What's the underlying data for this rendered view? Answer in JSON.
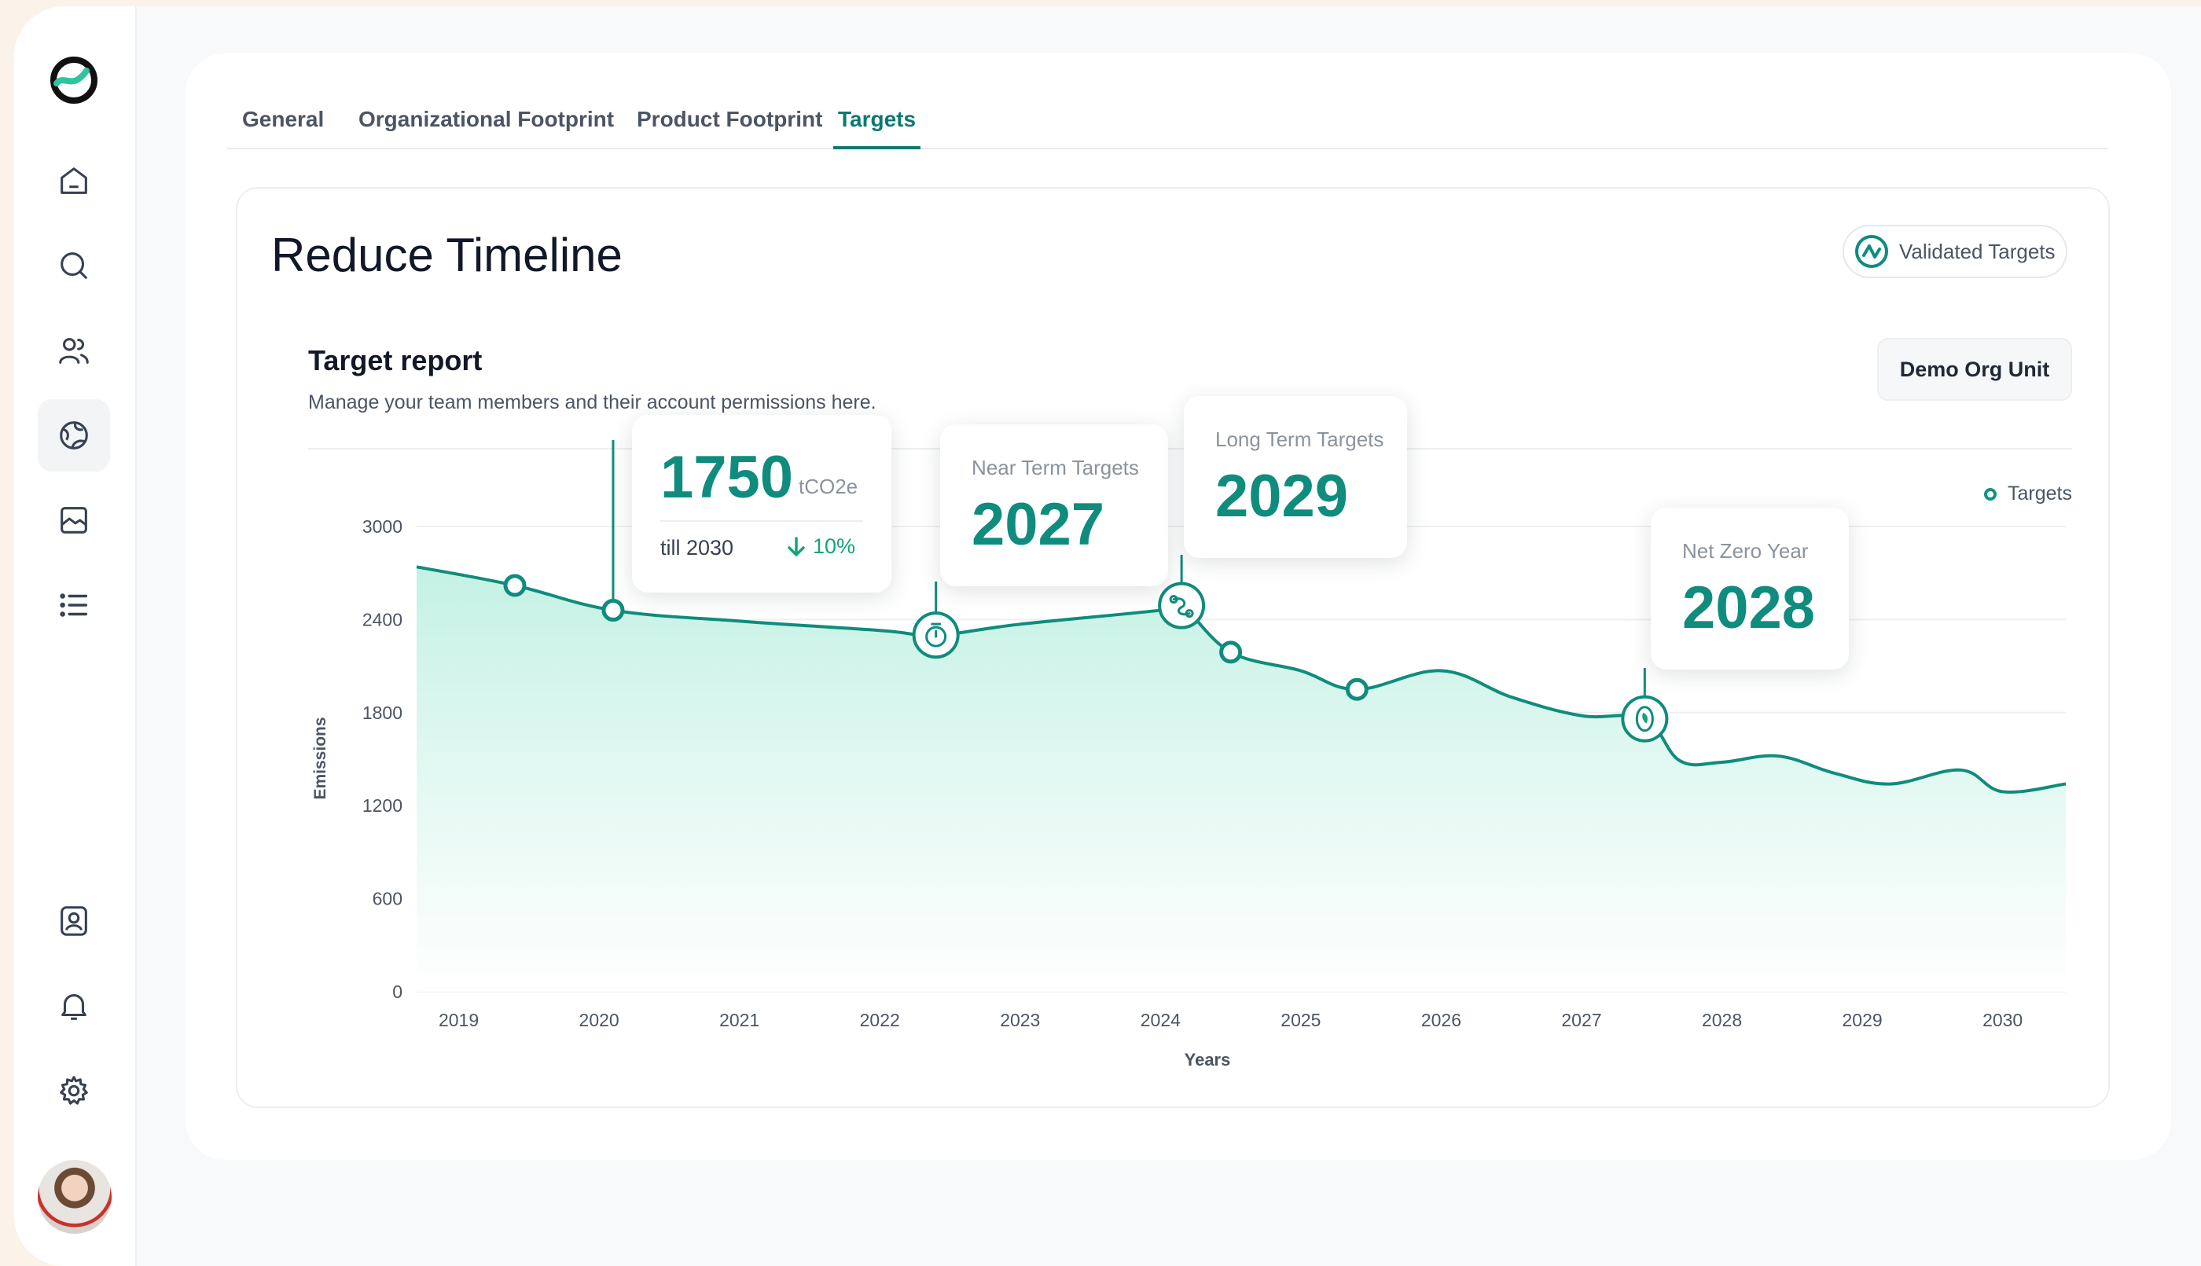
{
  "tabs": [
    {
      "label": "General"
    },
    {
      "label": "Organizational Footprint"
    },
    {
      "label": "Product Footprint"
    },
    {
      "label": "Targets"
    }
  ],
  "active_tab": "Targets",
  "page": {
    "title": "Reduce Timeline",
    "validated_label": "Validated Targets"
  },
  "report": {
    "title": "Target report",
    "subtitle": "Manage your team members and their account permissions here.",
    "org_unit": "Demo Org Unit"
  },
  "callouts": {
    "emission": {
      "value": "1750",
      "unit": "tCO2e",
      "till": "till 2030",
      "change": "10%"
    },
    "near_term": {
      "label": "Near Term Targets",
      "year": "2027"
    },
    "long_term": {
      "label": "Long Term Targets",
      "year": "2029"
    },
    "net_zero": {
      "label": "Net Zero Year",
      "year": "2028"
    }
  },
  "colors": {
    "accent": "#0f8c7d",
    "area_top": "#c9f3e8",
    "down": "#16a37a"
  },
  "sidebar": {
    "items": [
      {
        "icon": "home-icon"
      },
      {
        "icon": "search-icon"
      },
      {
        "icon": "users-icon"
      },
      {
        "icon": "globe-icon",
        "active": true
      },
      {
        "icon": "image-icon"
      },
      {
        "icon": "list-icon"
      },
      {
        "icon": "contact-icon"
      },
      {
        "icon": "bell-icon"
      },
      {
        "icon": "gear-icon"
      }
    ]
  },
  "chart_data": {
    "type": "area",
    "xlabel": "Years",
    "ylabel": "Emissions",
    "legend": [
      {
        "name": "Targets"
      }
    ],
    "legend_position": "top-right",
    "ylim": [
      0,
      3000
    ],
    "y_ticks": [
      0,
      600,
      1200,
      1800,
      2400,
      3000
    ],
    "x_ticks": [
      2019,
      2020,
      2021,
      2022,
      2023,
      2024,
      2025,
      2026,
      2027,
      2028,
      2029,
      2030
    ],
    "xlim": [
      2018.7,
      2030.45
    ],
    "series": [
      {
        "name": "Targets",
        "x": [
          2018.7,
          2019.4,
          2020.1,
          2021.0,
          2022.0,
          2022.4,
          2023.0,
          2024.0,
          2024.15,
          2024.5,
          2025.0,
          2025.4,
          2026.0,
          2026.5,
          2027.0,
          2027.45,
          2027.7,
          2028.0,
          2028.4,
          2028.8,
          2029.2,
          2029.7,
          2030.0,
          2030.45
        ],
        "values": [
          2740,
          2620,
          2460,
          2390,
          2330,
          2300,
          2370,
          2460,
          2490,
          2190,
          2070,
          1950,
          2070,
          1900,
          1780,
          1760,
          1490,
          1480,
          1520,
          1410,
          1340,
          1430,
          1290,
          1340
        ]
      }
    ],
    "markers": [
      {
        "x": 2019.4,
        "y": 2620
      },
      {
        "x": 2020.1,
        "y": 2460
      },
      {
        "x": 2022.4,
        "y": 2300,
        "icon": "timer-icon"
      },
      {
        "x": 2024.15,
        "y": 2490,
        "icon": "route-icon"
      },
      {
        "x": 2024.5,
        "y": 2190
      },
      {
        "x": 2025.4,
        "y": 1950
      },
      {
        "x": 2027.45,
        "y": 1760,
        "icon": "leaf-icon"
      }
    ]
  }
}
